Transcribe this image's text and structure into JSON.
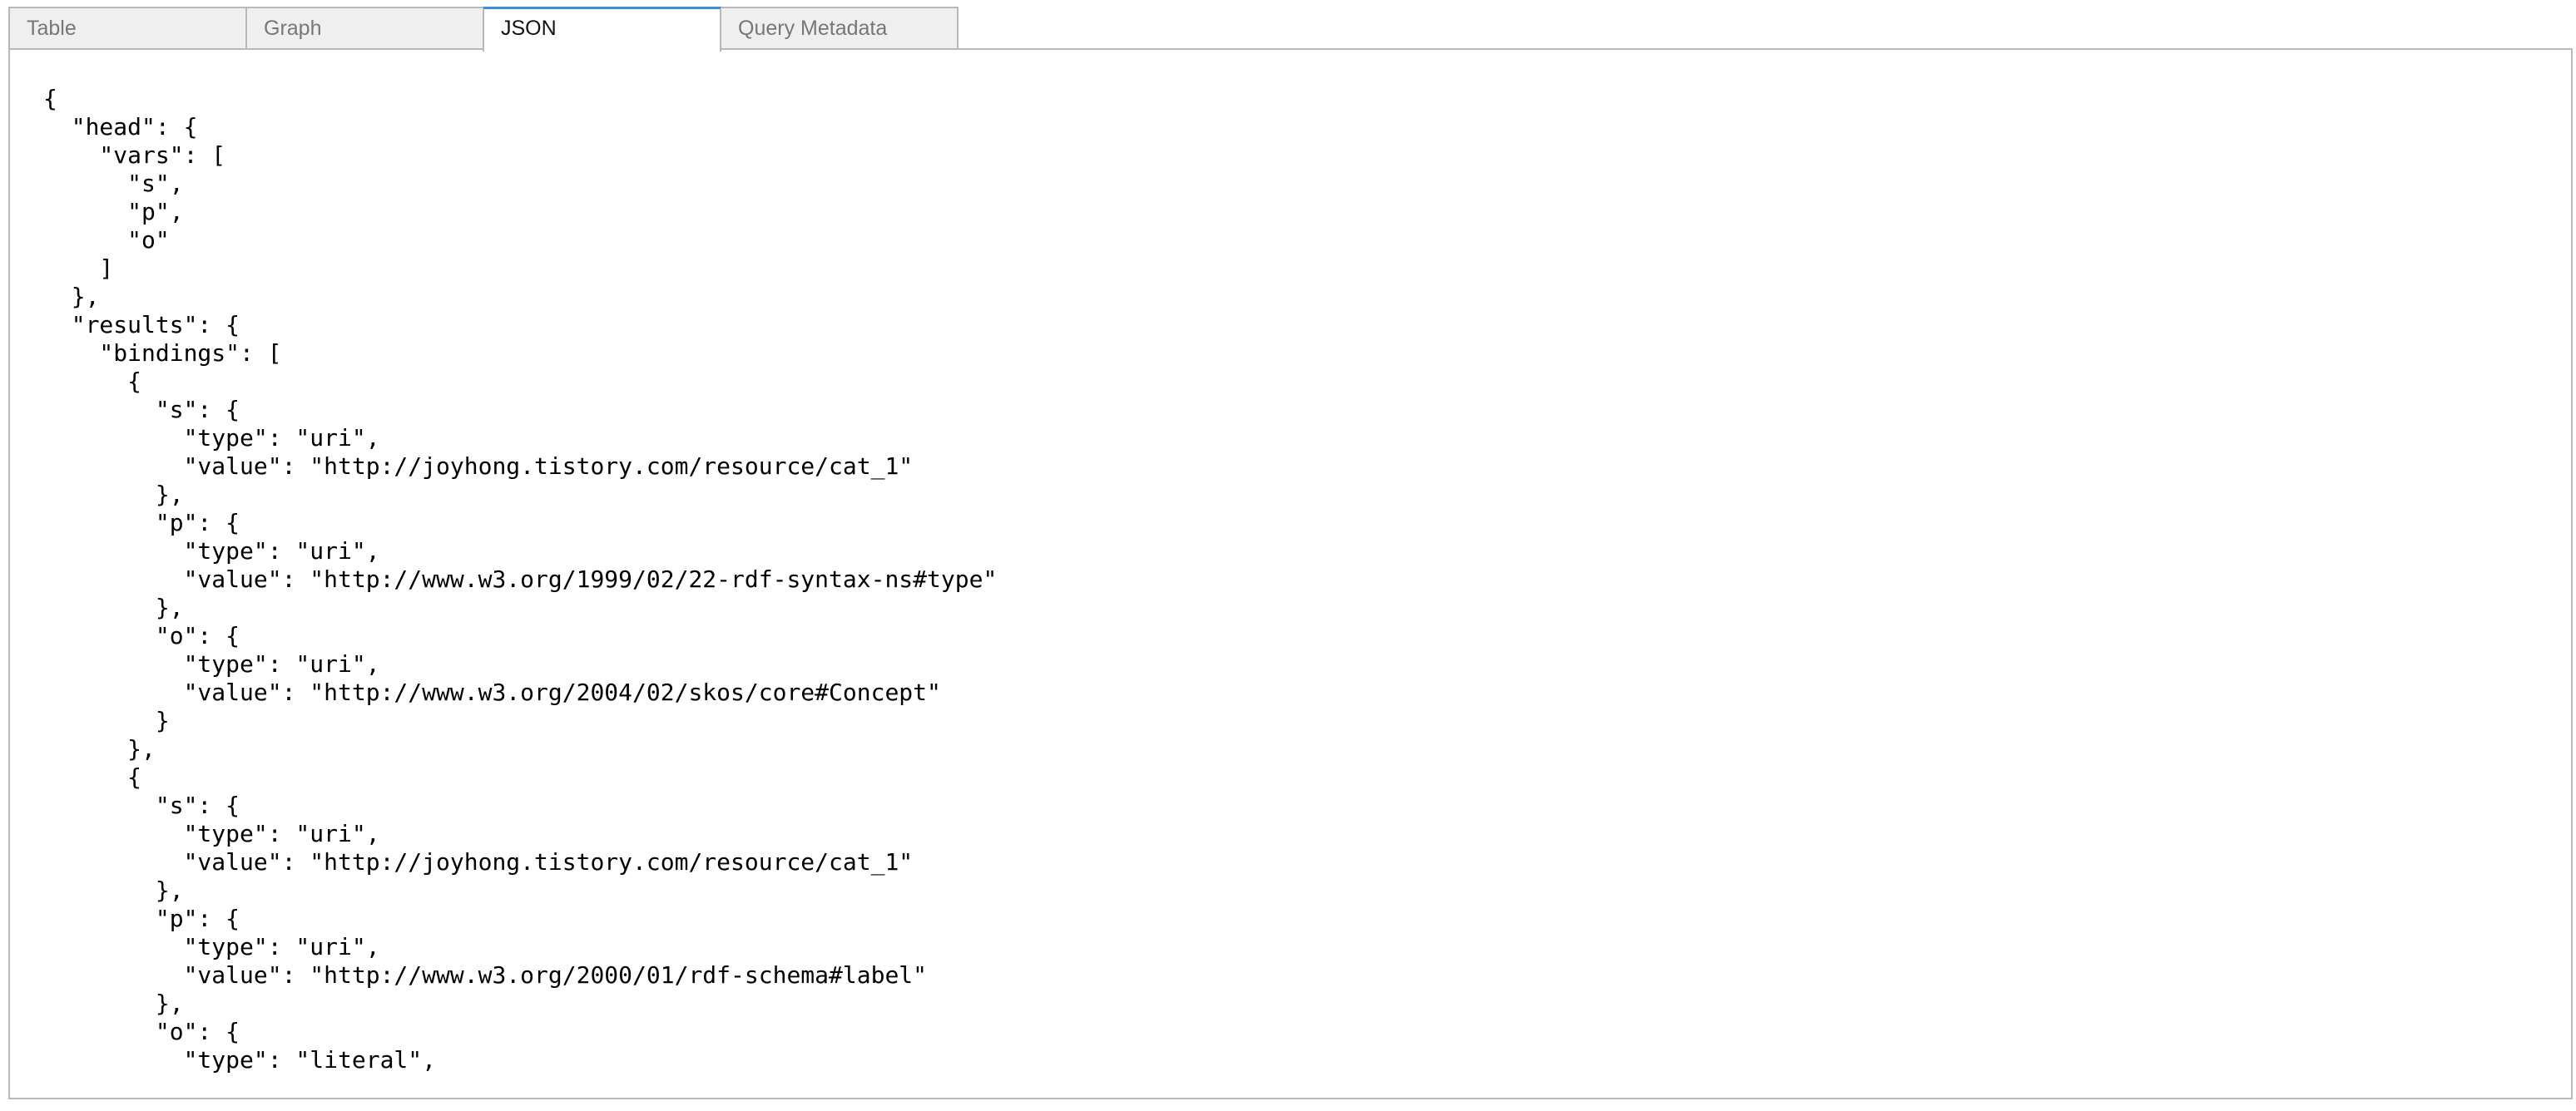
{
  "tabs": [
    {
      "label": "Table",
      "active": false
    },
    {
      "label": "Graph",
      "active": false
    },
    {
      "label": "JSON",
      "active": true
    },
    {
      "label": "Query Metadata",
      "active": false
    }
  ],
  "json_panel": {
    "lines": [
      "{",
      "  \"head\": {",
      "    \"vars\": [",
      "      \"s\",",
      "      \"p\",",
      "      \"o\"",
      "    ]",
      "  },",
      "  \"results\": {",
      "    \"bindings\": [",
      "      {",
      "        \"s\": {",
      "          \"type\": \"uri\",",
      "          \"value\": \"http://joyhong.tistory.com/resource/cat_1\"",
      "        },",
      "        \"p\": {",
      "          \"type\": \"uri\",",
      "          \"value\": \"http://www.w3.org/1999/02/22-rdf-syntax-ns#type\"",
      "        },",
      "        \"o\": {",
      "          \"type\": \"uri\",",
      "          \"value\": \"http://www.w3.org/2004/02/skos/core#Concept\"",
      "        }",
      "      },",
      "      {",
      "        \"s\": {",
      "          \"type\": \"uri\",",
      "          \"value\": \"http://joyhong.tistory.com/resource/cat_1\"",
      "        },",
      "        \"p\": {",
      "          \"type\": \"uri\",",
      "          \"value\": \"http://www.w3.org/2000/01/rdf-schema#label\"",
      "        },",
      "        \"o\": {",
      "          \"type\": \"literal\","
    ]
  }
}
